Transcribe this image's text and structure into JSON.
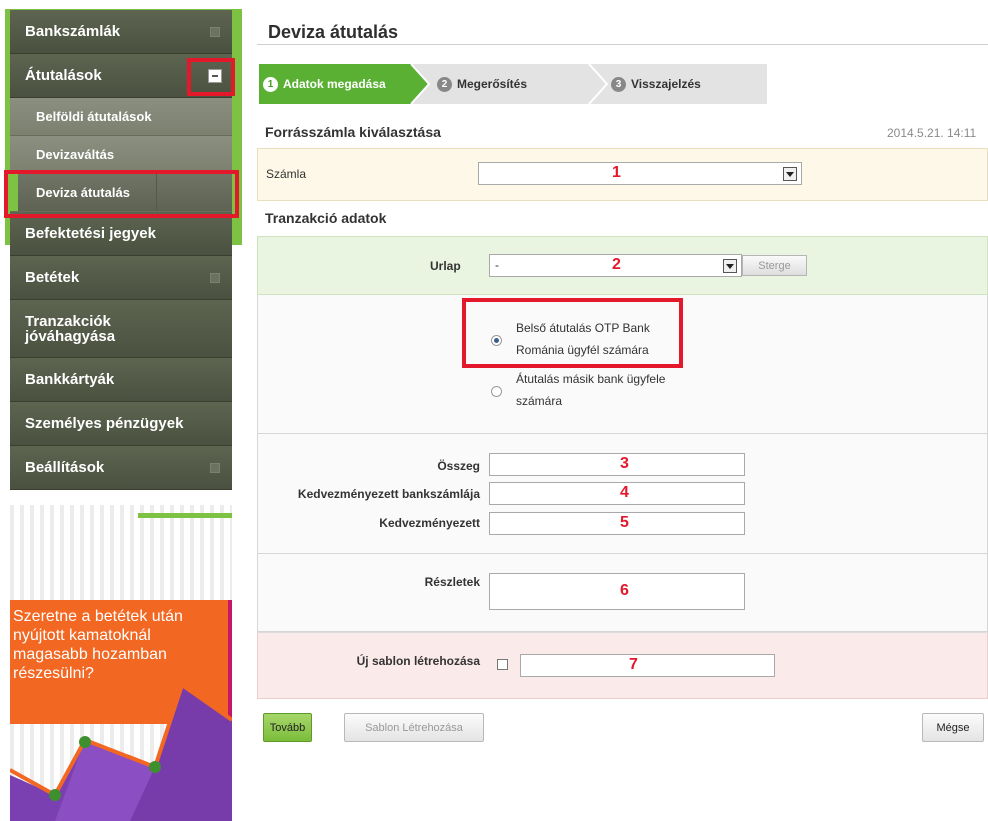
{
  "sidebar": {
    "items": [
      {
        "label": "Bankszámlák"
      },
      {
        "label": "Átutalások"
      },
      {
        "label": "Belföldi átutalások"
      },
      {
        "label": "Devizaváltás"
      },
      {
        "label": "Deviza átutalás"
      },
      {
        "label": "Befektetési jegyek"
      },
      {
        "label": "Betétek"
      },
      {
        "label": "Tranzakciók jóváhagyása"
      },
      {
        "label": "Bankkártyák"
      },
      {
        "label": "Személyes pénzügyek"
      },
      {
        "label": "Beállítások"
      }
    ]
  },
  "banner": {
    "text": "Szeretne a betétek után nyújtott kamatoknál magasabb hozamban részesülni?"
  },
  "main": {
    "title": "Deviza átutalás",
    "steps": [
      {
        "num": "1",
        "label": "Adatok megadása"
      },
      {
        "num": "2",
        "label": "Megerősítés"
      },
      {
        "num": "3",
        "label": "Visszajelzés"
      }
    ],
    "source_section": "Forrásszámla kiválasztása",
    "datetime": "2014.5.21. 14:11",
    "account_label": "Számla",
    "account_marker": "1",
    "transaction_section": "Tranzakció adatok",
    "form_label": "Urlap",
    "form_value": "-",
    "form_marker": "2",
    "clear_button": "Sterge",
    "radio1_line1": "Belső átutalás OTP Bank",
    "radio1_line2": "Románia ügyfél számára",
    "radio2_line1": "Átutalás másik bank ügyfele",
    "radio2_line2": "számára",
    "amount_label": "Összeg",
    "amount_marker": "3",
    "beneficiary_account_label": "Kedvezményezett bankszámlája",
    "beneficiary_account_marker": "4",
    "beneficiary_label": "Kedvezményezett",
    "beneficiary_marker": "5",
    "details_label": "Részletek",
    "details_marker": "6",
    "template_label": "Új sablon létrehozása",
    "template_marker": "7",
    "buttons": {
      "next": "Tovább",
      "create_template": "Sablon Létrehozása",
      "cancel": "Mégse"
    }
  }
}
